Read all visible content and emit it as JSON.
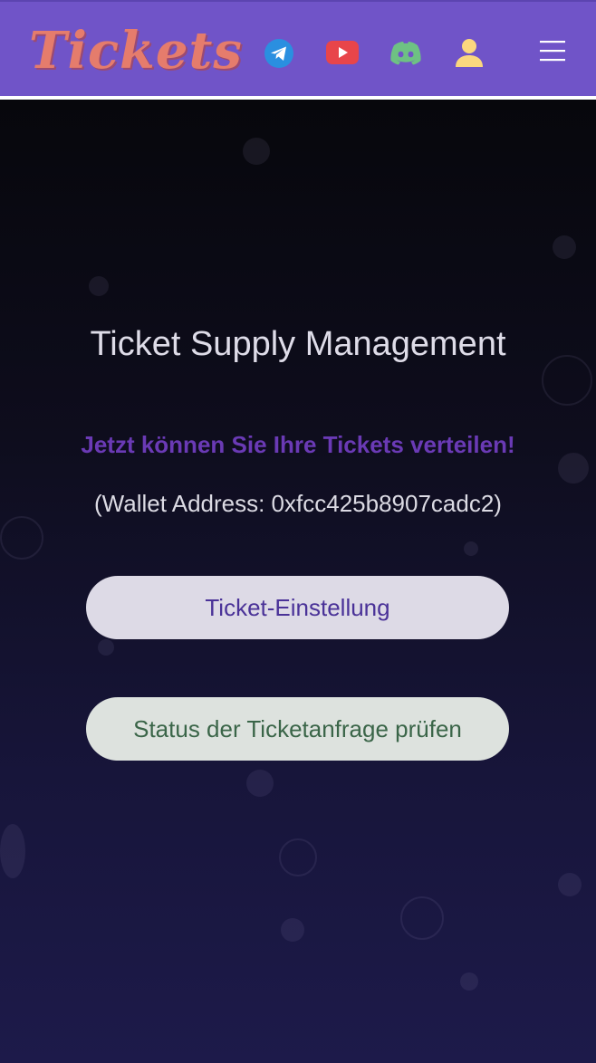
{
  "header": {
    "logo_text": "Tickets",
    "icons": {
      "telegram": "telegram-icon",
      "youtube": "youtube-icon",
      "discord": "discord-icon",
      "user": "user-icon",
      "menu": "menu-icon"
    }
  },
  "main": {
    "title": "Ticket Supply Management",
    "subtitle": "Jetzt können Sie Ihre Tickets verteilen!",
    "wallet": "(Wallet Address: 0xfcc425b8907cadc2)",
    "settings_button": "Ticket-Einstellung",
    "status_button": "Status der Ticketanfrage prüfen"
  },
  "colors": {
    "header_bg": "#7054c8",
    "logo": "#e57c6c",
    "subtitle": "#6a3ab5",
    "telegram": "#2a8fe0",
    "youtube": "#e8454a",
    "discord": "#6ec183",
    "user": "#fbd77e"
  }
}
